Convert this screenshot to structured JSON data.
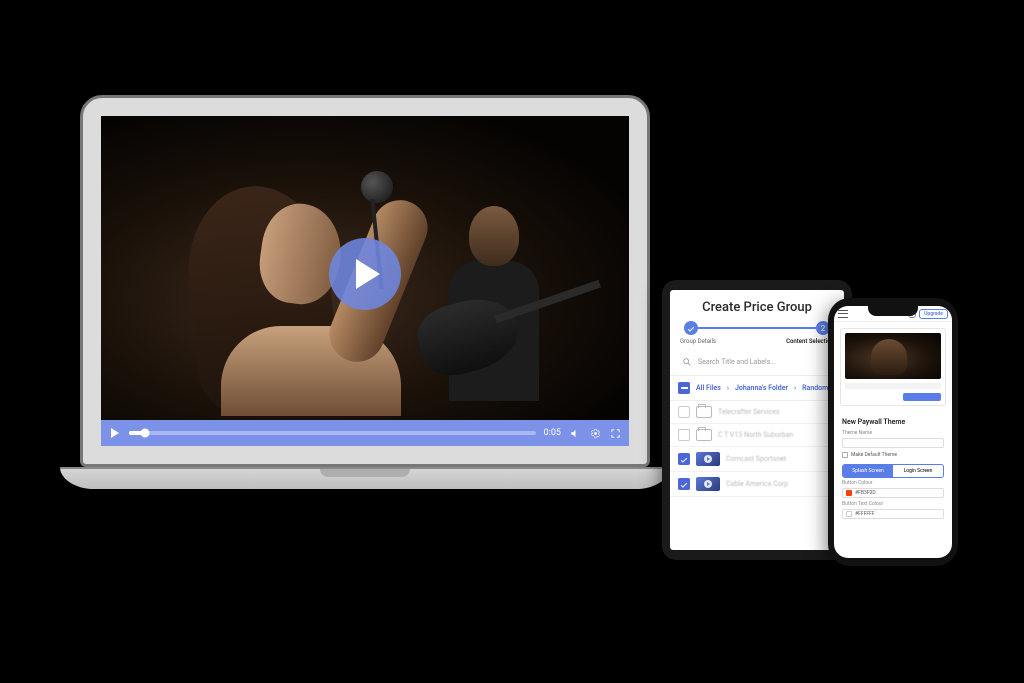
{
  "video_player": {
    "timestamp": "0:05"
  },
  "tablet_app": {
    "title": "Create Price Group",
    "steps": {
      "step1": "Group Details",
      "step2": "Content Selection"
    },
    "search_placeholder": "Search Title and Labels...",
    "breadcrumb": {
      "root": "All Files",
      "folder": "Johanna's Folder",
      "current": "Random"
    },
    "rows": [
      {
        "type": "folder",
        "label": "Telecrafter Services",
        "checked": false
      },
      {
        "type": "folder",
        "label": "C T V13 North Suburban",
        "checked": false
      },
      {
        "type": "video",
        "label": "Comcast Sportsnet",
        "checked": true
      },
      {
        "type": "video",
        "label": "Cable America Corp",
        "checked": true
      }
    ]
  },
  "phone_app": {
    "upgrade_label": "Upgrade",
    "section_title": "New Paywall Theme",
    "theme_name_label": "Theme Name",
    "make_default_label": "Make Default Theme",
    "tabs": {
      "splash": "Splash Screen",
      "login": "Login Screen"
    },
    "button_colour_label": "Button Colour",
    "button_colour_value": "#FB3F0D",
    "button_text_colour_label": "Button Text Colour",
    "button_text_colour_value": "#FFFFFF"
  },
  "colors": {
    "accent": "#5b7de8",
    "swatch1": "#fb3f0d"
  }
}
